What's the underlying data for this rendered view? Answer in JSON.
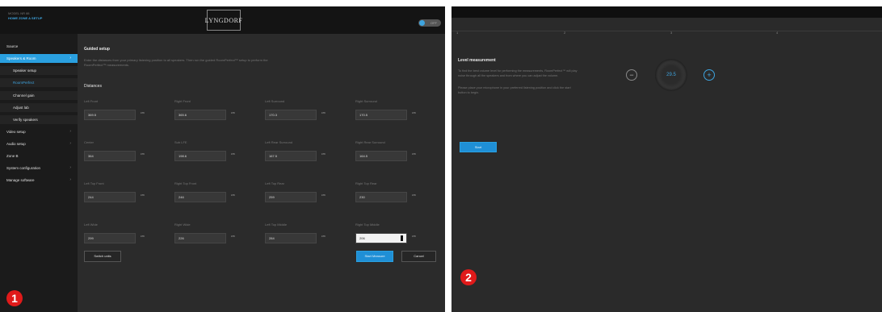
{
  "panel1": {
    "brand_model": "MODEL NR 88",
    "brand_path": "HOME ZONE A SETUP",
    "logo_text": "LYNGDORF",
    "toggle_label": "OFF",
    "badge": "1",
    "sidebar": {
      "items": [
        {
          "label": "Source",
          "chevron": ""
        },
        {
          "label": "Speakers & Room",
          "chevron": "›"
        },
        {
          "label": "Speaker setup",
          "chevron": ""
        },
        {
          "label": "RoomPerfect",
          "chevron": ""
        },
        {
          "label": "Channel gain",
          "chevron": ""
        },
        {
          "label": "Adjust lab",
          "chevron": ""
        },
        {
          "label": "Verify speakers",
          "chevron": ""
        },
        {
          "label": "Video setup",
          "chevron": "›"
        },
        {
          "label": "Audio setup",
          "chevron": "›"
        },
        {
          "label": "Zone B",
          "chevron": ""
        },
        {
          "label": "System configuration",
          "chevron": "›"
        },
        {
          "label": "Manage software",
          "chevron": "›"
        }
      ]
    },
    "content": {
      "title": "Guided setup",
      "description": "Enter the distances from your primary listening position to all speakers. Then run the guided RoomPerfect™ setup to perform the RoomPerfect™ measurements.",
      "section": "Distances",
      "unit": "cm",
      "fields": [
        {
          "label": "Left Front",
          "value": "369.5"
        },
        {
          "label": "Right Front",
          "value": "365.6"
        },
        {
          "label": "Left Surround",
          "value": "170.3"
        },
        {
          "label": "Right Surround",
          "value": "170.5"
        },
        {
          "label": "Center",
          "value": "364"
        },
        {
          "label": "Sub LFE",
          "value": "198.6"
        },
        {
          "label": "Left Rear Surround",
          "value": "167.5"
        },
        {
          "label": "Right Rear Surround",
          "value": "164.5"
        },
        {
          "label": "Left Top Front",
          "value": "244"
        },
        {
          "label": "Right Top Front",
          "value": "246"
        },
        {
          "label": "Left Top Rear",
          "value": "259"
        },
        {
          "label": "Right Top Rear",
          "value": "230"
        },
        {
          "label": "Left Wide",
          "value": "299"
        },
        {
          "label": "Right Wide",
          "value": "226"
        },
        {
          "label": "Left Top Middle",
          "value": "284"
        },
        {
          "label": "Right Top Middle",
          "value": "206"
        }
      ],
      "switch_units": "Switch units",
      "start_button": "Start Measure",
      "cancel_button": "Cancel"
    }
  },
  "panel2": {
    "badge": "2",
    "steps": [
      "1",
      "2",
      "3",
      "4"
    ],
    "title": "Level measurement",
    "description1": "To find the best volume level for performing the measurements, RoomPerfect™ will play noise through all the speakers and from where you can adjust the volume.",
    "description2": "Please place your microphone in your preferred listening position and click the start button to begin.",
    "level_value": "29.5",
    "minus": "−",
    "plus": "+",
    "start_button": "Start"
  }
}
